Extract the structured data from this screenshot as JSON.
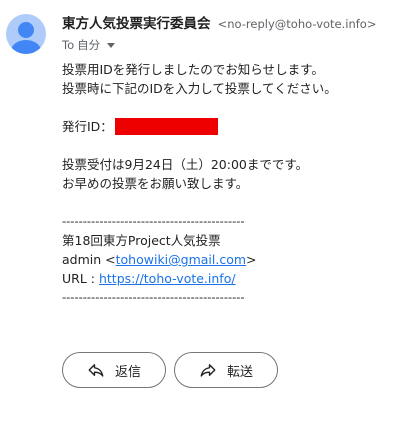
{
  "header": {
    "sender_name": "東方人気投票実行委員会",
    "sender_email": "<no-reply@toho-vote.info>",
    "to_prefix": "To",
    "to_recipient": "自分"
  },
  "body": {
    "line1": "投票用IDを発行しましたのでお知らせします。",
    "line2": "投票時に下記のIDを入力して投票してください。",
    "issued_id_label": "発行ID：",
    "deadline_line": "投票受付は9月24日（土）20:00までです。",
    "early_vote_line": "お早めの投票をお願い致します。",
    "separator": "--------------------------------------------",
    "event_name": "第18回東方Project人気投票",
    "admin_prefix": "admin <",
    "admin_email": "tohowiki@gmail.com",
    "admin_suffix": ">",
    "url_prefix": "URL : ",
    "url": "https://toho-vote.info/"
  },
  "actions": {
    "reply_label": "返信",
    "forward_label": "転送"
  },
  "colors": {
    "avatar_bg": "#aecbfa",
    "avatar_fg": "#4285f4",
    "link": "#1a73e8",
    "redaction": "#ee0000"
  },
  "icons": {
    "avatar": "person-icon",
    "reply": "reply-icon",
    "forward": "forward-icon",
    "recipients_toggle": "caret-down-icon"
  }
}
